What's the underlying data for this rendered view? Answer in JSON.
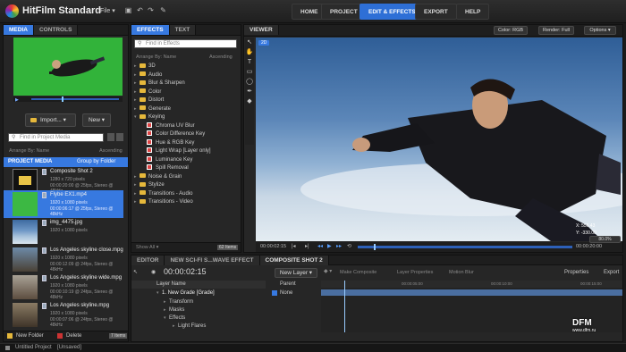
{
  "app": {
    "title": "HitFilm Standard",
    "file_menu": "File"
  },
  "nav": {
    "home": "HOME",
    "project": "PROJECT",
    "edit": "EDIT & EFFECTS",
    "export": "EXPORT",
    "help": "HELP"
  },
  "left": {
    "tabs": [
      "MEDIA",
      "CONTROLS"
    ],
    "import_label": "Import...",
    "new_label": "New",
    "search_placeholder": "Find in Project Media",
    "arrange_label": "Arrange By: Name",
    "ascending": "Ascending",
    "project_media": "PROJECT MEDIA",
    "group_by": "Group by Folder",
    "items": [
      {
        "name": "Composite Shot 2",
        "d1": "1280 x 720 pixels",
        "d2": "00:00:20:00 @ 25fps, Stereo @ 48kHz"
      },
      {
        "name": "Flybe EX1.mp4",
        "d1": "1920 x 1080 pixels",
        "d2": "00:00:06:17 @ 25fps, Stereo @ 48kHz"
      },
      {
        "name": "img_4475.jpg",
        "d1": "1920 x 1080 pixels",
        "d2": ""
      },
      {
        "name": "Los Angeles skyline close.mpg",
        "d1": "1920 x 1080 pixels",
        "d2": "00:00:12:09 @ 24fps, Stereo @ 48kHz"
      },
      {
        "name": "Los Angeles skyline wide.mpg",
        "d1": "1920 x 1080 pixels",
        "d2": "00:00:10:19 @ 24fps, Stereo @ 48kHz"
      },
      {
        "name": "Los Angeles skyline.mpg",
        "d1": "1920 x 1080 pixels",
        "d2": "00:00:07:06 @ 24fps, Stereo @ 48kHz"
      }
    ],
    "new_folder": "New Folder",
    "delete": "Delete",
    "items_count": "7 Items"
  },
  "effects": {
    "tabs": [
      "EFFECTS",
      "TEXT"
    ],
    "search_placeholder": "Find in Effects",
    "arrange_label": "Arrange By: Name",
    "ascending": "Ascending",
    "folders_top": [
      "3D",
      "Audio",
      "Blur & Sharpen",
      "Color",
      "Distort",
      "Generate",
      "Keying"
    ],
    "keying_items": [
      "Chroma UV Blur",
      "Color Difference Key",
      "Hue & RGB Key",
      "Light Wrap [Layer only]",
      "Luminance Key",
      "Spill Removal"
    ],
    "folders_bottom": [
      "Noise & Grain",
      "Stylize",
      "Transitions - Audio",
      "Transitions - Video"
    ],
    "show_all": "Show All",
    "count": "62 Items"
  },
  "viewer": {
    "tab": "VIEWER",
    "color": "Color: RGB",
    "render": "Render: Full",
    "options": "Options",
    "badge": "2D",
    "time_start": "00:00:02:15",
    "time_end": "00:00:20:00",
    "zoom": "80.0%",
    "coord_x": "X: 556.43",
    "coord_y": "Y: -330.00"
  },
  "timeline": {
    "tabs": [
      "EDITOR",
      "NEW SCI-FI S...WAVE EFFECT",
      "COMPOSITE SHOT 2"
    ],
    "timecode": "00:00:02:15",
    "new_layer": "New Layer",
    "make_composite": "Make Composite",
    "layer_properties": "Layer Properties",
    "motion_blur": "Motion Blur",
    "properties": "Properties",
    "export": "Export",
    "col_layer": "Layer Name",
    "col_parent": "Parent",
    "parent_value": "None",
    "layer_name": "1. New Grade [Grade]",
    "sublayers": [
      "Transform",
      "Masks",
      "Effects",
      "Light Flares"
    ],
    "ticks": [
      "00:00:05:00",
      "00:00:10:00",
      "00:00:15:00"
    ]
  },
  "status": {
    "project": "Untitled Project",
    "state": "[Unsaved]"
  },
  "watermark": {
    "line1": "DFM",
    "line2": "www.dfm.ru"
  }
}
